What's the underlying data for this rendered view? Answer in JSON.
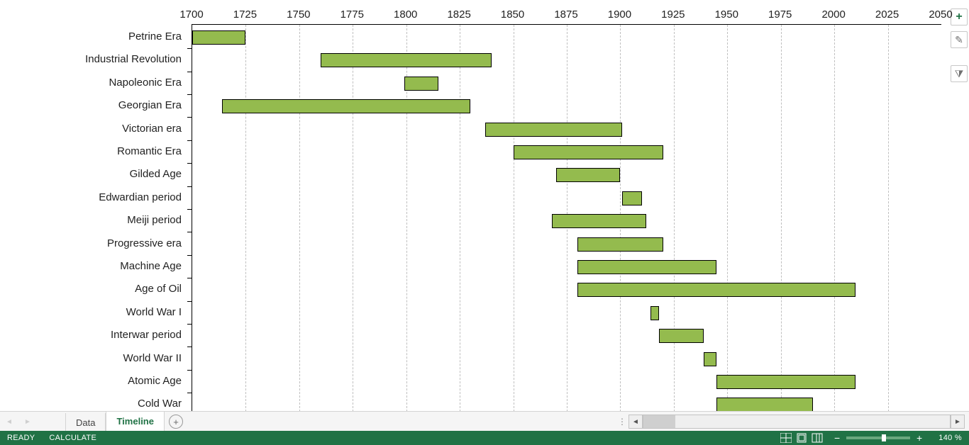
{
  "chart_data": {
    "type": "bar",
    "orientation": "horizontal-range",
    "xlabel": "",
    "ylabel": "",
    "xlim": [
      1700,
      2050
    ],
    "xticks": [
      1700,
      1725,
      1750,
      1775,
      1800,
      1825,
      1850,
      1875,
      1900,
      1925,
      1950,
      1975,
      2000,
      2025,
      2050
    ],
    "bar_color": "#94bb4e",
    "series": [
      {
        "name": "Petrine Era",
        "start": 1689,
        "end": 1725
      },
      {
        "name": "Industrial Revolution",
        "start": 1760,
        "end": 1840
      },
      {
        "name": "Napoleonic Era",
        "start": 1799,
        "end": 1815
      },
      {
        "name": "Georgian Era",
        "start": 1714,
        "end": 1830
      },
      {
        "name": "Victorian era",
        "start": 1837,
        "end": 1901
      },
      {
        "name": "Romantic Era",
        "start": 1850,
        "end": 1920
      },
      {
        "name": "Gilded Age",
        "start": 1870,
        "end": 1900
      },
      {
        "name": "Edwardian period",
        "start": 1901,
        "end": 1910
      },
      {
        "name": "Meiji period",
        "start": 1868,
        "end": 1912
      },
      {
        "name": "Progressive era",
        "start": 1880,
        "end": 1920
      },
      {
        "name": "Machine Age",
        "start": 1880,
        "end": 1945
      },
      {
        "name": "Age of Oil",
        "start": 1880,
        "end": 2010
      },
      {
        "name": "World War I",
        "start": 1914,
        "end": 1918
      },
      {
        "name": "Interwar period",
        "start": 1918,
        "end": 1939
      },
      {
        "name": "World War II",
        "start": 1939,
        "end": 1945
      },
      {
        "name": "Atomic Age",
        "start": 1945,
        "end": 2010
      },
      {
        "name": "Cold War",
        "start": 1945,
        "end": 1990
      }
    ]
  },
  "side_buttons": {
    "plus": "+",
    "brush": "✎",
    "filter": "⧩"
  },
  "tabs": {
    "items": [
      {
        "label": "Data",
        "active": false
      },
      {
        "label": "Timeline",
        "active": true
      }
    ],
    "add_glyph": "+"
  },
  "statusbar": {
    "ready": "READY",
    "calculate": "CALCULATE",
    "zoom_label": "140 %"
  }
}
